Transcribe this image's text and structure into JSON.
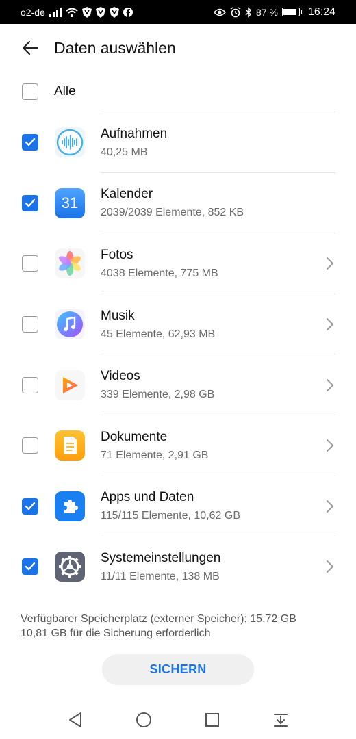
{
  "status_bar": {
    "carrier": "o2-de",
    "battery": "87 %",
    "time": "16:24",
    "battery_level": 0.87
  },
  "header": {
    "title": "Daten auswählen",
    "back_icon": "arrow-left-icon"
  },
  "select_all": {
    "label": "Alle",
    "checked": false
  },
  "items": [
    {
      "title": "Aufnahmen",
      "subtitle": "40,25 MB",
      "checked": true,
      "icon": "recorder-icon",
      "chevron": false
    },
    {
      "title": "Kalender",
      "subtitle": "2039/2039 Elemente, 852 KB",
      "checked": true,
      "icon": "calendar-icon",
      "icon_text": "31",
      "chevron": false
    },
    {
      "title": "Fotos",
      "subtitle": "4038 Elemente, 775 MB",
      "checked": false,
      "icon": "photos-icon",
      "chevron": true
    },
    {
      "title": "Musik",
      "subtitle": "45 Elemente, 62,93 MB",
      "checked": false,
      "icon": "music-icon",
      "chevron": true
    },
    {
      "title": "Videos",
      "subtitle": "339 Elemente, 2,98 GB",
      "checked": false,
      "icon": "videos-icon",
      "chevron": true
    },
    {
      "title": "Dokumente",
      "subtitle": "71 Elemente, 2,91 GB",
      "checked": false,
      "icon": "documents-icon",
      "chevron": true
    },
    {
      "title": "Apps und Daten",
      "subtitle": "115/115 Elemente, 10,62 GB",
      "checked": true,
      "icon": "apps-icon",
      "chevron": true
    },
    {
      "title": "Systemeinstellungen",
      "subtitle": "11/11 Elemente, 138 MB",
      "checked": true,
      "icon": "settings-icon",
      "chevron": true
    }
  ],
  "storage": {
    "available": "Verfügbarer Speicherplatz (externer Speicher): 15,72 GB",
    "required": "10,81 GB für die Sicherung erforderlich"
  },
  "backup_button": {
    "label": "SICHERN"
  },
  "nav": {
    "back_icon": "triangle-back-icon",
    "home_icon": "circle-home-icon",
    "recents_icon": "square-recents-icon",
    "notifications_icon": "pull-down-icon"
  },
  "colors": {
    "accent": "#1a73e8",
    "text_primary": "#111111",
    "text_secondary": "#6b6b6b"
  }
}
